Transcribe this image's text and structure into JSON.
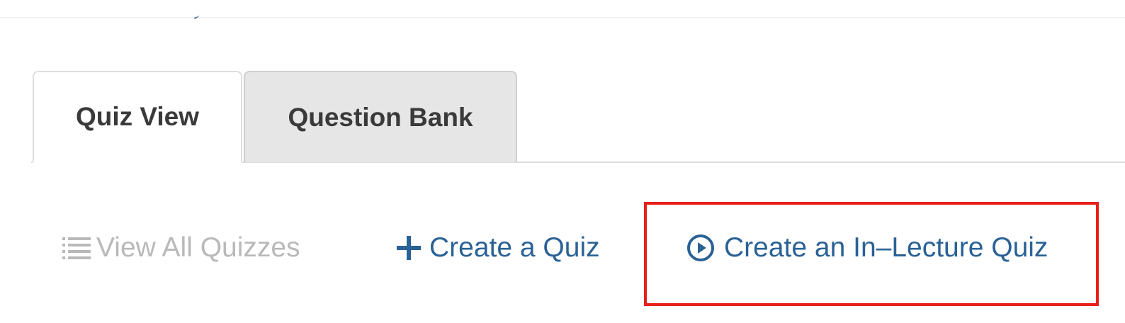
{
  "tabs": [
    {
      "label": "Quiz View",
      "active": true
    },
    {
      "label": "Question Bank",
      "active": false
    }
  ],
  "actions": {
    "view_all": {
      "label": "View All Quizzes",
      "icon": "list-icon",
      "enabled": false
    },
    "create_quiz": {
      "label": "Create a Quiz",
      "icon": "plus-icon",
      "enabled": true
    },
    "create_in_lecture": {
      "label": "Create an In–Lecture Quiz",
      "icon": "play-circle-icon",
      "enabled": true,
      "highlighted": true
    }
  },
  "colors": {
    "link": "#2a6296",
    "disabled": "#b9b9b9",
    "highlight": "#e8201c",
    "tab_inactive_bg": "#e6e6e6",
    "tab_text": "#3a3a3a"
  }
}
